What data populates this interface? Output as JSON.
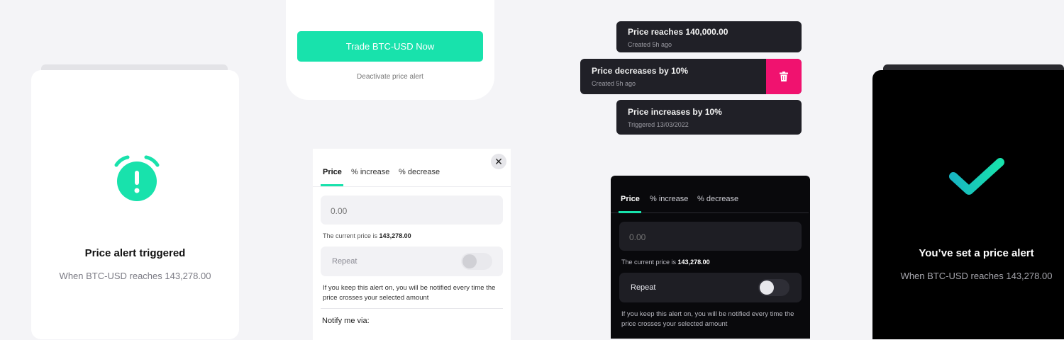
{
  "triggered_card": {
    "title": "Price alert triggered",
    "subtitle": "When BTC-USD reaches 143,278.00",
    "icon": "alarm-clock-exclamation-icon",
    "accent": "#18e2ac"
  },
  "trade_card": {
    "trade_button": "Trade BTC-USD Now",
    "deactivate_link": "Deactivate price alert"
  },
  "light_form": {
    "close_symbol": "✕",
    "tabs": [
      {
        "label": "Price",
        "active": true
      },
      {
        "label": "% increase",
        "active": false
      },
      {
        "label": "% decrease",
        "active": false
      }
    ],
    "price_placeholder": "0.00",
    "current_price_prefix": "The current price is",
    "current_price_value": "143,278.00",
    "repeat_label": "Repeat",
    "repeat_on": false,
    "repeat_info": "If you keep this alert on, you will be notified every time the price crosses your selected amount",
    "notify_label": "Notify me via:"
  },
  "alerts": [
    {
      "title": "Price reaches 140,000.00",
      "status": "Created 5h ago"
    },
    {
      "title": "Price decreases by 10%",
      "status": "Created 5h ago",
      "delete_color": "#f0126f"
    },
    {
      "title": "Price increases by 10%",
      "status": "Triggered 13/03/2022"
    }
  ],
  "dark_form": {
    "tabs": [
      {
        "label": "Price",
        "active": true
      },
      {
        "label": "% increase",
        "active": false
      },
      {
        "label": "% decrease",
        "active": false
      }
    ],
    "price_placeholder": "0.00",
    "current_price_prefix": "The current price is",
    "current_price_value": "143,278.00",
    "repeat_label": "Repeat",
    "repeat_on": false,
    "repeat_info": "If you keep this alert on, you will be notified every time the price crosses your selected amount"
  },
  "set_card": {
    "title": "You’ve set a price alert",
    "subtitle": "When BTC-USD reaches 143,278.00",
    "icon": "checkmark-icon"
  }
}
